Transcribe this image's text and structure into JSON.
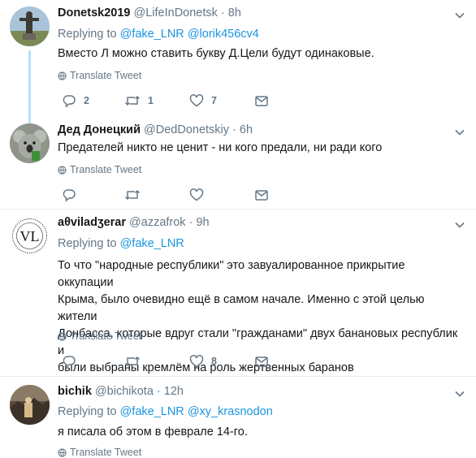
{
  "tweets": [
    {
      "name": "Donetsk2019",
      "handle": "@LifeInDonetsk",
      "time": "8h",
      "replying_prefix": "Replying to",
      "mentions": [
        "@fake_LNR",
        "@lorik456cv4"
      ],
      "text": "Вместо Л можно ставить букву Д.Цели будут одинаковые.",
      "translate": "Translate Tweet",
      "replies": "2",
      "retweets": "1",
      "likes": "7"
    },
    {
      "name": "Дед Донецкий",
      "handle": "@DedDonetskiy",
      "time": "6h",
      "text": "Предателей никто не ценит - ни кого предали, ни ради кого",
      "translate": "Translate Tweet",
      "replies": "",
      "retweets": "",
      "likes": ""
    },
    {
      "name": "aθviladʒerar",
      "handle": "@azzafrok",
      "time": "9h",
      "replying_prefix": "Replying to",
      "mentions": [
        "@fake_LNR"
      ],
      "text_lines": [
        "То что \"народные республики\" это завуалированное прикрытие оккупации",
        "Крыма, было очевидно ещё в самом начале. Именно с этой целью жители",
        "Донбасса, которые вдруг стали \"гражданами\" двух банановых республик и",
        "были выбраны кремлём на роль жертвенных баранов"
      ],
      "translate": "Translate Tweet",
      "replies": "",
      "retweets": "",
      "likes": "8"
    },
    {
      "name": "bichik",
      "handle": "@bichikota",
      "time": "12h",
      "replying_prefix": "Replying to",
      "mentions": [
        "@fake_LNR",
        "@xy_krasnodon"
      ],
      "text": "я писала об этом в феврале 14-го.",
      "translate": "Translate Tweet"
    }
  ],
  "separator": "·",
  "avatar_logo_letters": "VL",
  "avatar_logo_ring_text": "AVANT GARDE · VILAD · ZHERAR",
  "colors": {
    "link": "#1b95e0",
    "muted": "#657786",
    "text": "#14171a",
    "thread_line": "#b5e3fb",
    "divider": "#e6ecf0"
  },
  "icons": [
    "chevron-down-icon",
    "globe-icon",
    "reply-icon",
    "retweet-icon",
    "like-icon",
    "message-icon"
  ]
}
